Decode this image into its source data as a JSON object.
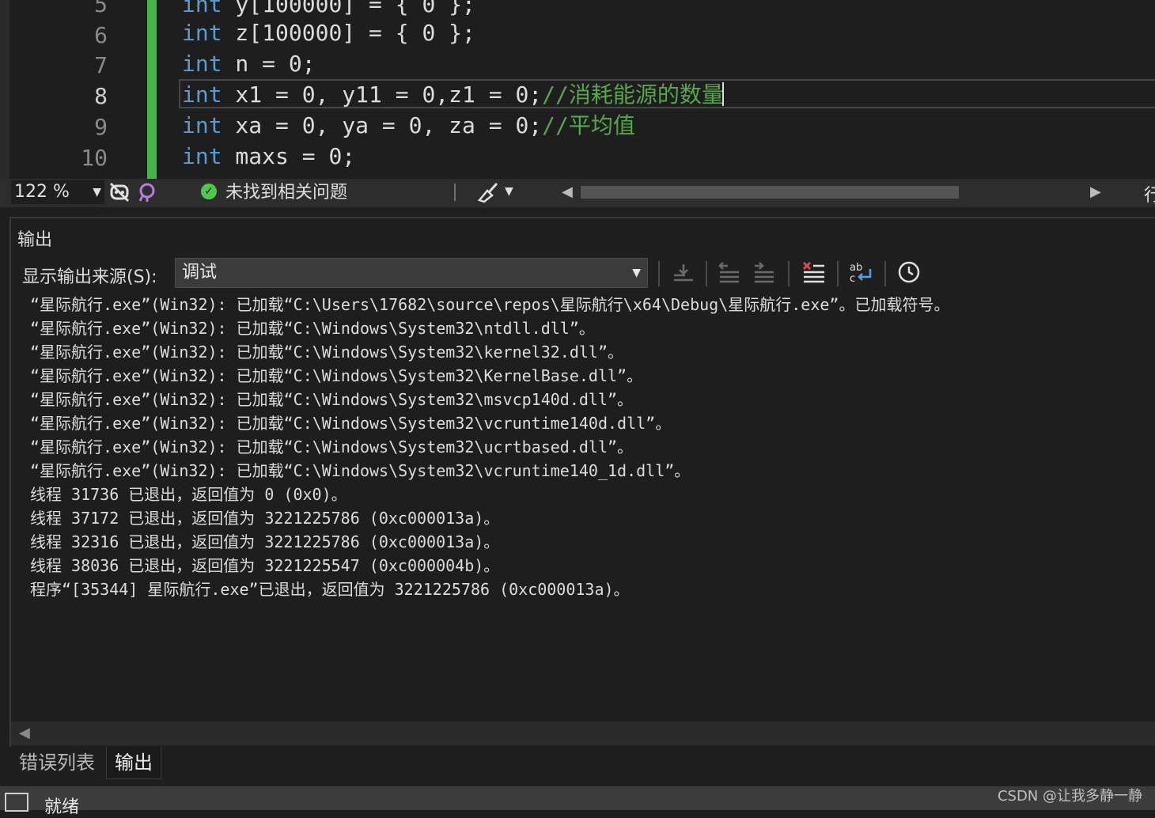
{
  "editor": {
    "line_numbers": [
      "5",
      "6",
      "7",
      "8",
      "9",
      "10"
    ],
    "lines": [
      {
        "kw": "int",
        "rest": " y[100000] = { 0 };"
      },
      {
        "kw": "int",
        "rest": " z[100000] = { 0 };"
      },
      {
        "kw": "int",
        "rest": " n = 0;"
      },
      {
        "kw": "int",
        "rest": " x1 = 0, y11 = 0,z1 = 0;",
        "comment": "//消耗能源的数量"
      },
      {
        "kw": "int",
        "rest": " xa = 0, ya = 0, za = 0;",
        "comment": "//平均值"
      },
      {
        "kw": "int",
        "rest": " maxs = 0;"
      }
    ]
  },
  "editor_status": {
    "zoom": "122 %",
    "issues_text": "未找到相关问题",
    "right_edge_text": "行"
  },
  "output_panel": {
    "title": "输出",
    "source_label": "显示输出来源(S):",
    "source_value": "调试",
    "lines": [
      "“星际航行.exe”(Win32): 已加载“C:\\Users\\17682\\source\\repos\\星际航行\\x64\\Debug\\星际航行.exe”。已加载符号。",
      "“星际航行.exe”(Win32): 已加载“C:\\Windows\\System32\\ntdll.dll”。",
      "“星际航行.exe”(Win32): 已加载“C:\\Windows\\System32\\kernel32.dll”。",
      "“星际航行.exe”(Win32): 已加载“C:\\Windows\\System32\\KernelBase.dll”。",
      "“星际航行.exe”(Win32): 已加载“C:\\Windows\\System32\\msvcp140d.dll”。",
      "“星际航行.exe”(Win32): 已加载“C:\\Windows\\System32\\vcruntime140d.dll”。",
      "“星际航行.exe”(Win32): 已加载“C:\\Windows\\System32\\ucrtbased.dll”。",
      "“星际航行.exe”(Win32): 已加载“C:\\Windows\\System32\\vcruntime140_1d.dll”。",
      "线程 31736 已退出，返回值为 0 (0x0)。",
      "线程 37172 已退出，返回值为 3221225786 (0xc000013a)。",
      "线程 32316 已退出，返回值为 3221225786 (0xc000013a)。",
      "线程 38036 已退出，返回值为 3221225547 (0xc000004b)。",
      "程序“[35344] 星际航行.exe”已退出，返回值为 3221225786 (0xc000013a)。"
    ]
  },
  "tabs": [
    {
      "label": "错误列表",
      "active": false
    },
    {
      "label": "输出",
      "active": true
    }
  ],
  "status_bar": {
    "text": "就绪"
  },
  "watermark": "CSDN @让我多静一静",
  "colors": {
    "keyword": "#569cd6",
    "number": "#b5cea8",
    "comment": "#57a64a",
    "change_bar": "#48b348",
    "ok_icon": "#4ec94e"
  },
  "icons": {
    "toolbar": [
      "goto-code-icon",
      "prev-message-icon",
      "next-message-icon",
      "clear-all-icon",
      "word-wrap-icon",
      "timestamp-icon"
    ]
  }
}
